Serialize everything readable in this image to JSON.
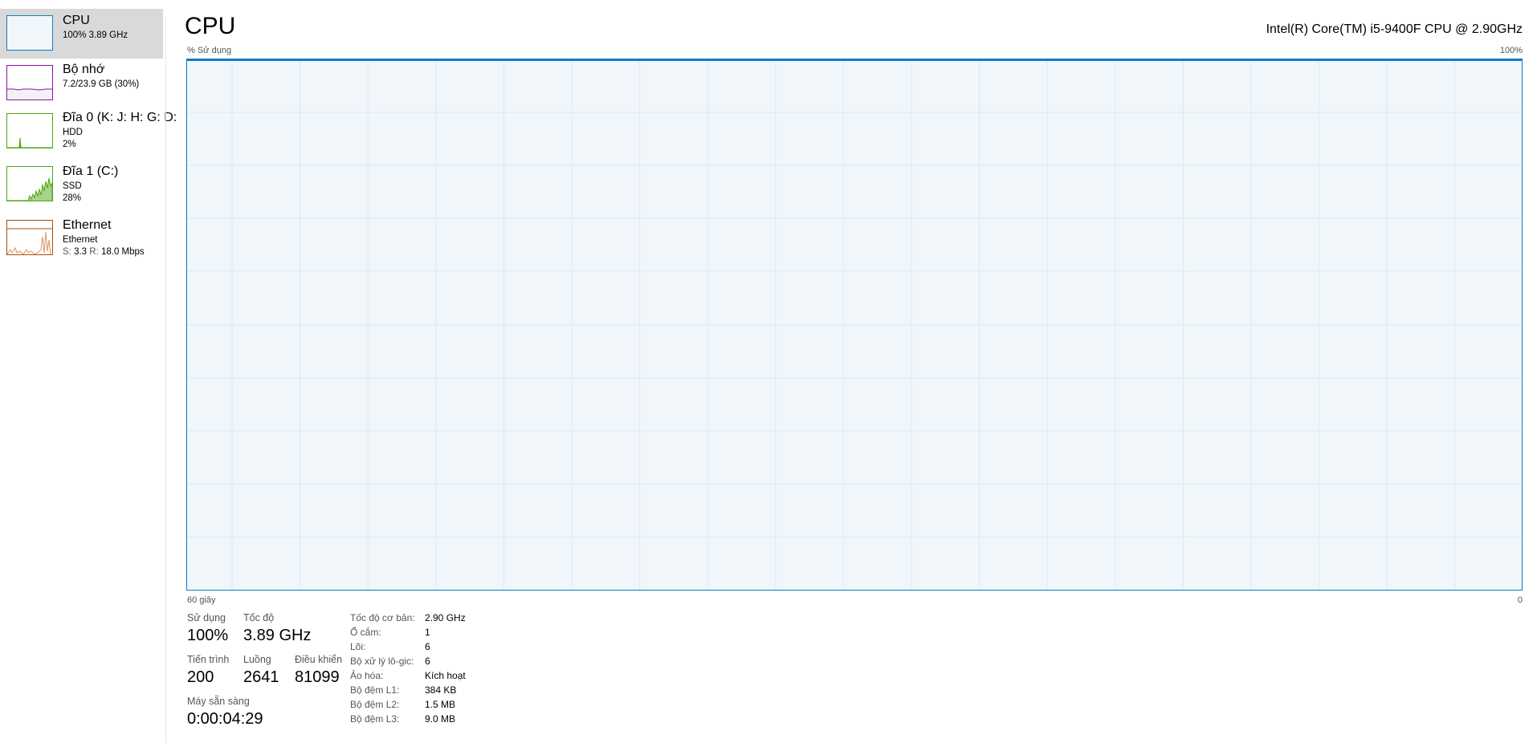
{
  "sidebar": {
    "items": [
      {
        "title": "CPU",
        "sub1": "100%  3.89 GHz",
        "color": "#117dbb",
        "fill": "#f1f6fa",
        "active": true
      },
      {
        "title": "Bộ nhớ",
        "sub1": "7.2/23.9 GB (30%)",
        "color": "#8b12ae",
        "fill": "#f4f2f4"
      },
      {
        "title": "Đĩa 0 (K: J: H: G: D:",
        "sub1": "HDD",
        "sub2": "2%",
        "color": "#4da60c",
        "fill": "#eff4ea"
      },
      {
        "title": "Đĩa 1 (C:)",
        "sub1": "SSD",
        "sub2": "28%",
        "color": "#4da60c",
        "fill": "#eff4ea"
      },
      {
        "title": "Ethernet",
        "sub1": "Ethernet",
        "sub2_prefix_s": "S:",
        "sub2_s": "3.3",
        "sub2_prefix_r": "R:",
        "sub2_r": "18.0 Mbps",
        "color": "#a74f01",
        "fill": "#fcf3eb"
      }
    ]
  },
  "header": {
    "title": "CPU",
    "cpu_name": "Intel(R) Core(TM) i5-9400F CPU @ 2.90GHz",
    "usage_label": "% Sử dụng",
    "max_label": "100%",
    "time_label": "60 giây",
    "min_label": "0"
  },
  "graph": {
    "line_color": "#117dbb",
    "bg_color": "#f1f6fa",
    "grid_color": "#d9eaf4",
    "usage_percent": 100
  },
  "stats": {
    "usage_label": "Sử dụng",
    "usage_value": "100%",
    "speed_label": "Tốc độ",
    "speed_value": "3.89 GHz",
    "processes_label": "Tiến trình",
    "processes_value": "200",
    "threads_label": "Luồng",
    "threads_value": "2641",
    "handles_label": "Điều khiển",
    "handles_value": "81099",
    "uptime_label": "Máy sẵn sàng",
    "uptime_value": "0:00:04:29"
  },
  "specs": [
    {
      "key": "Tốc độ cơ bản:",
      "value": "2.90 GHz"
    },
    {
      "key": "Ổ cắm:",
      "value": "1"
    },
    {
      "key": "Lõi:",
      "value": "6"
    },
    {
      "key": "Bộ xử lý lô-gic:",
      "value": "6"
    },
    {
      "key": "Ảo hóa:",
      "value": "Kích hoạt"
    },
    {
      "key": "Bộ đệm L1:",
      "value": "384 KB"
    },
    {
      "key": "Bộ đệm L2:",
      "value": "1.5 MB"
    },
    {
      "key": "Bộ đệm L3:",
      "value": "9.0 MB"
    }
  ]
}
